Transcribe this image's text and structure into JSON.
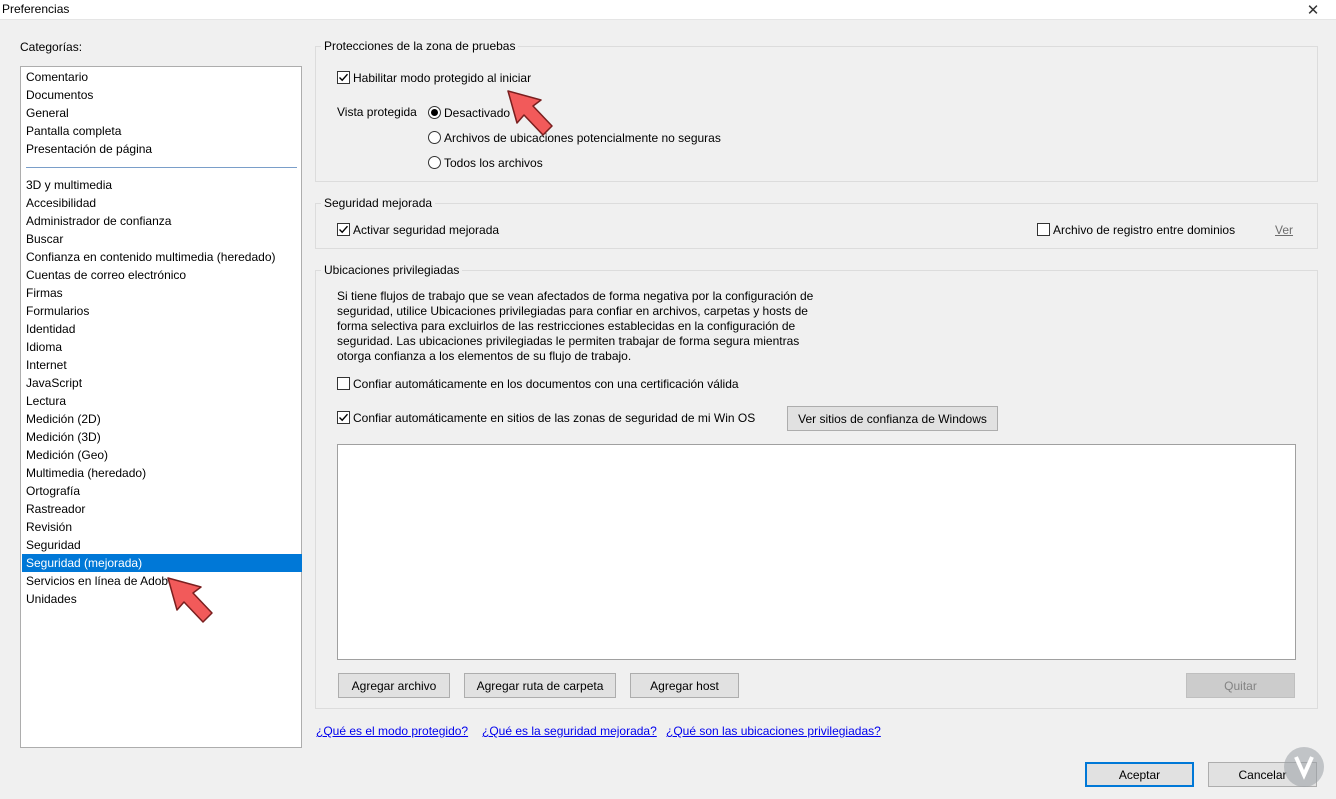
{
  "window": {
    "title": "Preferencias",
    "close_label": "✕"
  },
  "sidebar": {
    "heading": "Categorías:",
    "items_top": [
      "Comentario",
      "Documentos",
      "General",
      "Pantalla completa",
      "Presentación de página"
    ],
    "items": [
      "3D y multimedia",
      "Accesibilidad",
      "Administrador de confianza",
      "Buscar",
      "Confianza en contenido multimedia (heredado)",
      "Cuentas de correo electrónico",
      "Firmas",
      "Formularios",
      "Identidad",
      "Idioma",
      "Internet",
      "JavaScript",
      "Lectura",
      "Medición (2D)",
      "Medición (3D)",
      "Medición (Geo)",
      "Multimedia (heredado)",
      "Ortografía",
      "Rastreador",
      "Revisión",
      "Seguridad",
      "Seguridad (mejorada)",
      "Servicios en línea de Adobe",
      "Unidades"
    ],
    "selected": "Seguridad (mejorada)"
  },
  "sandbox": {
    "title": "Protecciones de la zona de pruebas",
    "enable_protected_label": "Habilitar modo protegido al iniciar",
    "enable_protected_checked": true,
    "protected_view_label": "Vista protegida",
    "options": [
      "Desactivado",
      "Archivos de ubicaciones potencialmente no seguras",
      "Todos los archivos"
    ],
    "selected_option": "Desactivado"
  },
  "enhanced": {
    "title": "Seguridad mejorada",
    "activate_label": "Activar seguridad mejorada",
    "activate_checked": true,
    "crossdomain_label": "Archivo de registro entre dominios",
    "crossdomain_checked": false,
    "view_link": "Ver"
  },
  "privileged": {
    "title": "Ubicaciones privilegiadas",
    "description_lines": [
      "Si tiene flujos de trabajo que se vean afectados de forma negativa por la configuración de",
      "seguridad, utilice Ubicaciones privilegiadas para confiar en archivos, carpetas y hosts de",
      "forma selectiva para excluirlos de las restricciones establecidas en la configuración de",
      "seguridad. Las ubicaciones privilegiadas le permiten trabajar de forma segura mientras",
      "otorga confianza a los elementos de su flujo de trabajo."
    ],
    "trust_certified_label": "Confiar automáticamente en los documentos con una certificación válida",
    "trust_certified_checked": false,
    "trust_os_label": "Confiar automáticamente en sitios de las zonas de seguridad de mi Win OS",
    "trust_os_checked": true,
    "view_windows_sites_button": "Ver sitios de confianza de Windows",
    "add_file_button": "Agregar archivo",
    "add_folder_button": "Agregar ruta de carpeta",
    "add_host_button": "Agregar host",
    "remove_button": "Quitar"
  },
  "help_links": [
    "¿Qué es el modo protegido?",
    "¿Qué es la seguridad mejorada?",
    "¿Qué son las ubicaciones privilegiadas?"
  ],
  "footer": {
    "ok_button": "Aceptar",
    "cancel_button": "Cancelar"
  },
  "colors": {
    "selection": "#0078d7",
    "link": "#0000ee",
    "annotation_arrow": "#f25a5a"
  }
}
